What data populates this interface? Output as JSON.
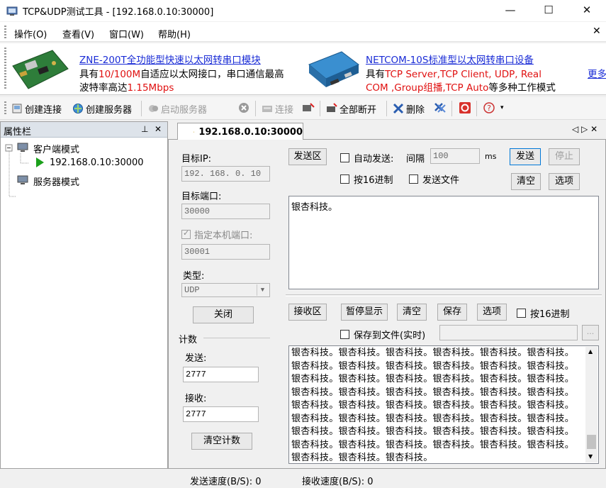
{
  "window": {
    "title": "TCP&UDP测试工具 - [192.168.0.10:30000]",
    "minimize": "—",
    "maximize": "☐",
    "close": "✕"
  },
  "menu": {
    "items": [
      "操作(O)",
      "查看(V)",
      "窗口(W)",
      "帮助(H)"
    ],
    "close_glyph": "✕"
  },
  "banner": {
    "ad1": {
      "title": "ZNE-200T全功能型快速以太网转串口模块",
      "line1_a": "具有",
      "line1_b": "10/100M",
      "line1_c": "自适应以太网接口，串口通信最高",
      "line2_a": "波特率高达",
      "line2_b": "1.15Mbps"
    },
    "ad2": {
      "title": "NETCOM-10S标准型以太网转串口设备",
      "line1_a": "具有",
      "line1_b": "TCP Server,TCP Client, UDP, Real",
      "line2_a": "COM ,Group组播,TCP Auto",
      "line2_b": "等多种工作模式"
    },
    "more": "更多"
  },
  "toolbar": {
    "create_conn": "创建连接",
    "create_server": "创建服务器",
    "start_server": "启动服务器",
    "connect": "连接",
    "disconnect_all": "全部断开",
    "delete": "删除"
  },
  "left_panel": {
    "title": "属性栏",
    "pin": "⊥",
    "close": "✕",
    "client_mode": "客户端模式",
    "connection": "192.168.0.10:30000",
    "server_mode": "服务器模式"
  },
  "tab": {
    "label": "192.168.0.10:30000",
    "nav": "◁ ▷ ✕"
  },
  "settings": {
    "target_ip_label": "目标IP:",
    "target_ip": "192. 168. 0. 10",
    "target_port_label": "目标端口:",
    "target_port": "30000",
    "local_port_label": "指定本机端口:",
    "local_port": "30001",
    "type_label": "类型:",
    "type_value": "UDP",
    "close_button": "关闭",
    "count_label": "计数",
    "send_label": "发送:",
    "send_count": "2777",
    "recv_label": "接收:",
    "recv_count": "2777",
    "clear_count": "清空计数"
  },
  "send": {
    "area_button": "发送区",
    "auto_send": "自动发送:",
    "interval_label": "间隔",
    "interval_value": "100",
    "ms": "ms",
    "send_button": "发送",
    "stop_button": "停止",
    "hex16": "按16进制",
    "send_file": "发送文件",
    "clear_button": "清空",
    "options_button": "选项",
    "content": "银杏科技。"
  },
  "receive": {
    "area_button": "接收区",
    "pause_button": "暂停显示",
    "clear_button": "清空",
    "save_button": "保存",
    "options_button": "选项",
    "hex16": "按16进制",
    "save_to_file": "保存到文件(实时)",
    "browse": "...",
    "content": "银杏科技。银杏科技。银杏科技。银杏科技。银杏科技。银杏科技。银杏科技。银杏科技。银杏科技。银杏科技。银杏科技。银杏科技。银杏科技。银杏科技。银杏科技。银杏科技。银杏科技。银杏科技。银杏科技。银杏科技。银杏科技。银杏科技。银杏科技。银杏科技。银杏科技。银杏科技。银杏科技。银杏科技。银杏科技。银杏科技。银杏科技。银杏科技。银杏科技。银杏科技。银杏科技。银杏科技。银杏科技。银杏科技。银杏科技。银杏科技。银杏科技。银杏科技。银杏科技。银杏科技。银杏科技。银杏科技。银杏科技。银杏科技。银杏科技。银杏科技。银杏科技。"
  },
  "status": {
    "send_speed": "发送速度(B/S): 0",
    "recv_speed": "接收速度(B/S): 0"
  }
}
